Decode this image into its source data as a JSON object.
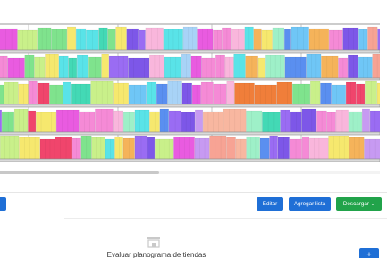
{
  "actions": {
    "edit_label": "Editar",
    "add_list_label": "Agregar lista",
    "download_label": "Descargar",
    "download_chevron": "⌄"
  },
  "empty_state": {
    "title": "Evaluar planograma de tiendas",
    "icon": "store-icon"
  },
  "fab": {
    "icon": "plus-icon",
    "label": "+"
  },
  "planogram": {
    "scroll_fraction": 0.43,
    "palette": {
      "pink": "#f58ad6",
      "magenta": "#e95be0",
      "violet": "#9a6cf3",
      "purple": "#7d57e8",
      "blue": "#5a8ff0",
      "sky": "#6fc6f6",
      "cyan": "#59e3e8",
      "teal": "#43d9b5",
      "green": "#7fe38d",
      "lime": "#c9f08a",
      "yellow": "#f6e86e",
      "orange": "#f5b35a",
      "deeporange": "#f07e3a",
      "red": "#f0456c",
      "salmon": "#f7a394",
      "peach": "#f8b7a0",
      "lavender": "#c79af2",
      "mint": "#9ef0c8",
      "lightblue": "#a8d3f7",
      "lightpink": "#f9b6dc"
    },
    "shelves": [
      {
        "products": [
          "pink",
          "magenta",
          "lime",
          "green",
          "green",
          "yellow",
          "cyan",
          "cyan",
          "teal",
          "green",
          "yellow",
          "purple",
          "violet",
          "lightpink",
          "cyan",
          "lightblue",
          "magenta",
          "pink",
          "pink",
          "lightpink",
          "cyan",
          "orange",
          "yellow",
          "mint",
          "blue",
          "sky",
          "orange",
          "pink",
          "purple",
          "sky",
          "salmon",
          "violet"
        ]
      },
      {
        "products": [
          "pink",
          "magenta",
          "green",
          "lime",
          "yellow",
          "cyan",
          "teal",
          "cyan",
          "green",
          "yellow",
          "violet",
          "purple",
          "lightpink",
          "cyan",
          "lightblue",
          "magenta",
          "pink",
          "pink",
          "lightpink",
          "cyan",
          "orange",
          "yellow",
          "mint",
          "blue",
          "sky",
          "orange",
          "pink",
          "purple",
          "sky",
          "salmon",
          "violet"
        ]
      },
      {
        "products": [
          "green",
          "lime",
          "yellow",
          "pink",
          "red",
          "green",
          "cyan",
          "teal",
          "lime",
          "yellow",
          "sky",
          "cyan",
          "blue",
          "lightblue",
          "purple",
          "magenta",
          "pink",
          "pink",
          "lightpink",
          "deeporange",
          "deeporange",
          "deeporange",
          "green",
          "lime",
          "blue",
          "sky",
          "red",
          "red",
          "lime",
          "yellow"
        ]
      },
      {
        "products": [
          "violet",
          "green",
          "lime",
          "red",
          "yellow",
          "magenta",
          "pink",
          "pink",
          "lightpink",
          "mint",
          "cyan",
          "yellow",
          "blue",
          "violet",
          "purple",
          "lavender",
          "peach",
          "peach",
          "mint",
          "teal",
          "violet",
          "purple",
          "purple",
          "pink",
          "pink",
          "lightpink",
          "mint",
          "lavender",
          "violet"
        ]
      },
      {
        "products": [
          "green",
          "lime",
          "yellow",
          "red",
          "red",
          "pink",
          "green",
          "lime",
          "cyan",
          "yellow",
          "orange",
          "violet",
          "purple",
          "lime",
          "magenta",
          "lavender",
          "salmon",
          "salmon",
          "peach",
          "mint",
          "blue",
          "violet",
          "purple",
          "pink",
          "pink",
          "lightpink",
          "yellow",
          "orange",
          "lavender",
          "blue"
        ]
      }
    ]
  }
}
